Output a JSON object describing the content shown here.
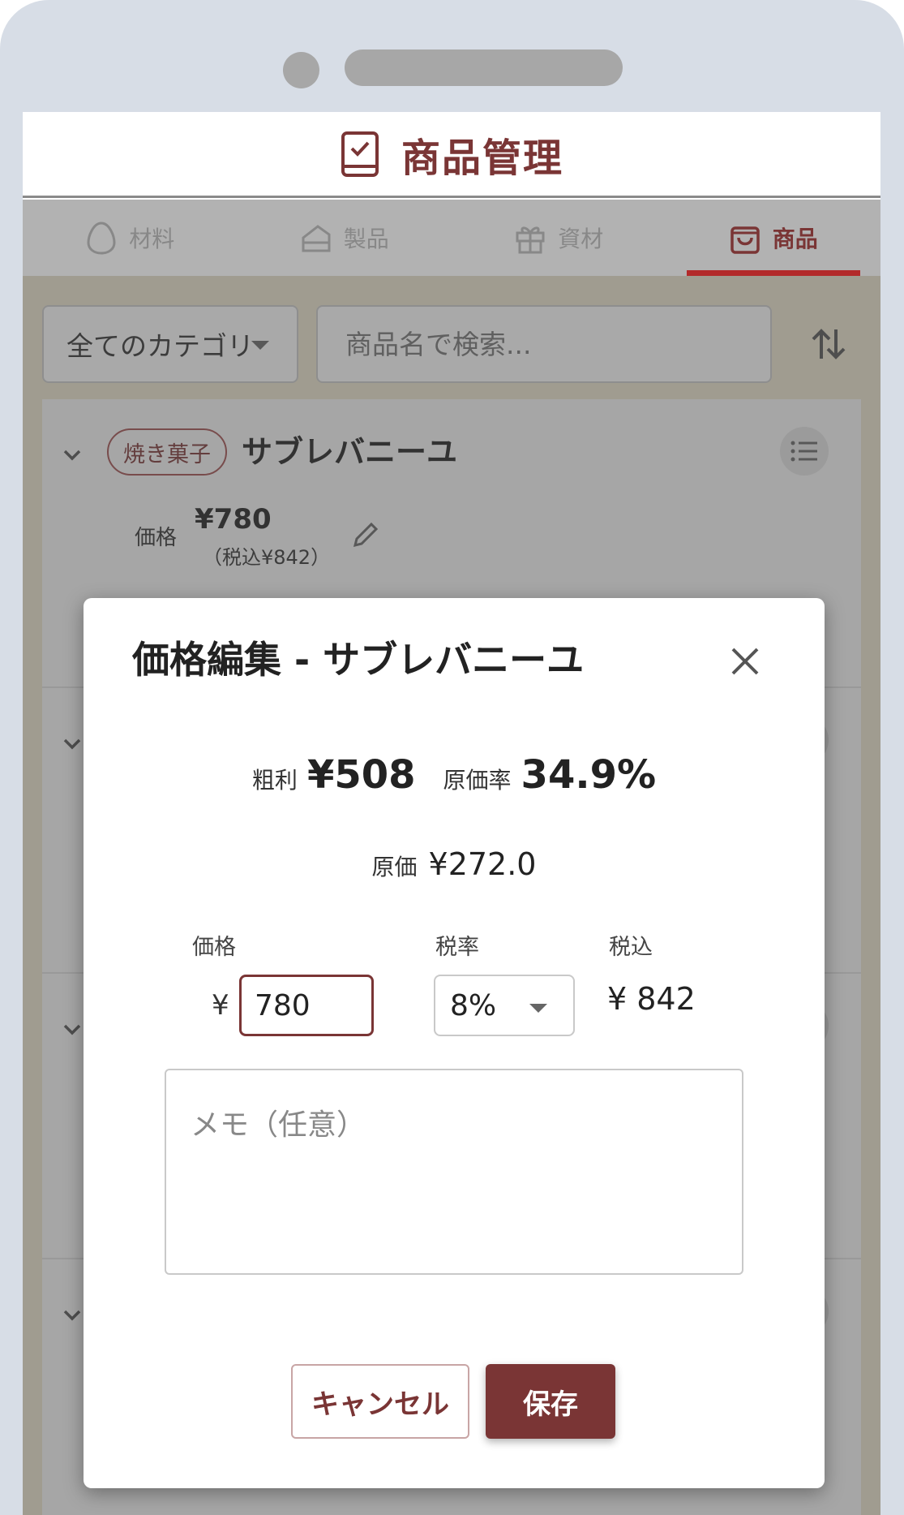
{
  "app": {
    "title": "商品管理"
  },
  "tabs": [
    {
      "label": "材料",
      "icon": "egg-icon"
    },
    {
      "label": "製品",
      "icon": "cake-icon"
    },
    {
      "label": "資材",
      "icon": "gift-icon"
    },
    {
      "label": "商品",
      "icon": "shopping-bag-icon",
      "active": true
    }
  ],
  "filter": {
    "category": "全てのカテゴリ",
    "search_placeholder": "商品名で検索..."
  },
  "product": {
    "badge": "焼き菓子",
    "name": "サブレバニーユ",
    "price_label": "価格",
    "price": "¥780",
    "price_tax": "（税込¥842）"
  },
  "dialog": {
    "title": "価格編集 - サブレバニーユ",
    "gross_profit_label": "粗利",
    "gross_profit": "¥508",
    "cost_ratio_label": "原価率",
    "cost_ratio": "34.9%",
    "cost_label": "原価",
    "cost": "¥272.0",
    "price_label": "価格",
    "tax_rate_label": "税率",
    "tax_included_label": "税込",
    "yen_symbol": "¥",
    "price_value": "780",
    "tax_rate": "8%",
    "tax_included_value": "¥ 842",
    "memo_placeholder": "メモ（任意）",
    "cancel_label": "キャンセル",
    "save_label": "保存"
  },
  "colors": {
    "brand": "#7a3535",
    "tab_indicator": "#b32a2a"
  }
}
